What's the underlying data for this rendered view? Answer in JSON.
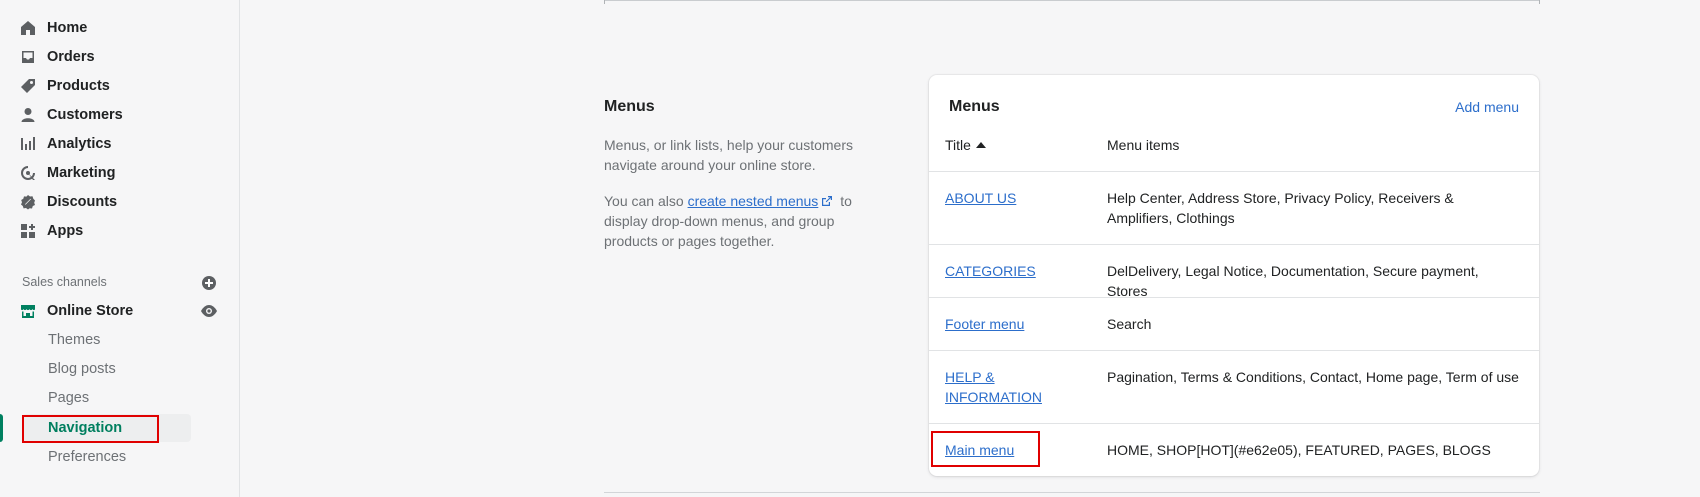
{
  "sidebar": {
    "items": [
      {
        "label": "Home",
        "icon": "home-icon"
      },
      {
        "label": "Orders",
        "icon": "inbox-icon"
      },
      {
        "label": "Products",
        "icon": "tag-icon"
      },
      {
        "label": "Customers",
        "icon": "person-icon"
      },
      {
        "label": "Analytics",
        "icon": "bar-chart-icon"
      },
      {
        "label": "Marketing",
        "icon": "target-icon"
      },
      {
        "label": "Discounts",
        "icon": "discount-icon"
      },
      {
        "label": "Apps",
        "icon": "apps-icon"
      }
    ],
    "sales_channels_label": "Sales channels",
    "online_store": {
      "label": "Online Store",
      "icon": "store-icon"
    },
    "sub_items": [
      "Themes",
      "Blog posts",
      "Pages",
      "Navigation",
      "Preferences"
    ],
    "active_sub_item": "Navigation",
    "accent_color": "#008060"
  },
  "main": {
    "section_title": "Menus",
    "description_1": "Menus, or link lists, help your customers navigate around your online store.",
    "description_2_prefix": "You can also ",
    "description_2_link": "create nested menus",
    "description_2_suffix": " to display drop-down menus, and group products or pages together.",
    "card": {
      "title": "Menus",
      "add_label": "Add menu",
      "col_title": "Title",
      "col_items": "Menu items",
      "rows": [
        {
          "title": "ABOUT US",
          "items": "Help Center, Address Store, Privacy Policy, Receivers & Amplifiers, Clothings"
        },
        {
          "title": "CATEGORIES",
          "items": "DelDelivery, Legal Notice, Documentation, Secure payment, Stores"
        },
        {
          "title": "Footer menu",
          "items": "Search"
        },
        {
          "title": "HELP & INFORMATION",
          "items": "Pagination, Terms & Conditions, Contact, Home page, Term of use"
        },
        {
          "title": "Main menu",
          "items": "HOME, SHOP[HOT](#e62e05), FEATURED, PAGES, BLOGS"
        }
      ]
    },
    "link_color": "#2c6ecb",
    "highlight_color": "#e00000"
  }
}
